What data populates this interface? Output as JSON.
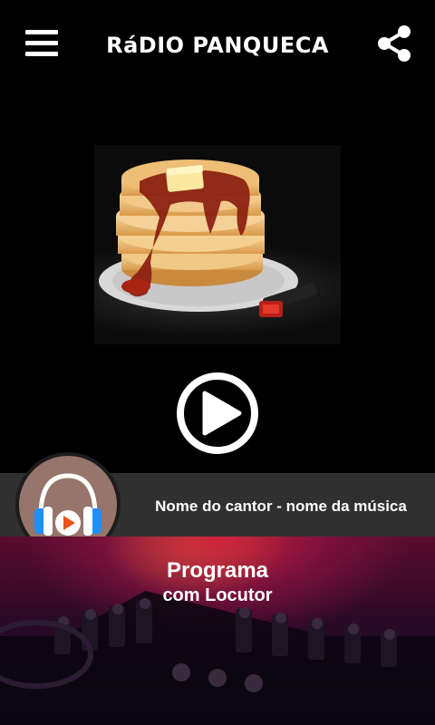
{
  "header": {
    "title": "RáDIO PANQUECA",
    "menu_icon": "hamburger-menu-icon",
    "share_icon": "share-icon"
  },
  "player": {
    "play_icon": "play-icon",
    "album_art": "pancake-stack-on-vinyl-record"
  },
  "now_playing": {
    "text": "Nome do cantor - nome da música",
    "logo_icon": "headphones-play-logo-icon"
  },
  "program": {
    "title": "Programa",
    "host": "com Locutor"
  },
  "colors": {
    "background": "#000000",
    "now_playing_bar": "#303030",
    "logo_bg": "#96756b",
    "headphone_blue": "#1e90ff",
    "play_orange": "#e8541c"
  }
}
